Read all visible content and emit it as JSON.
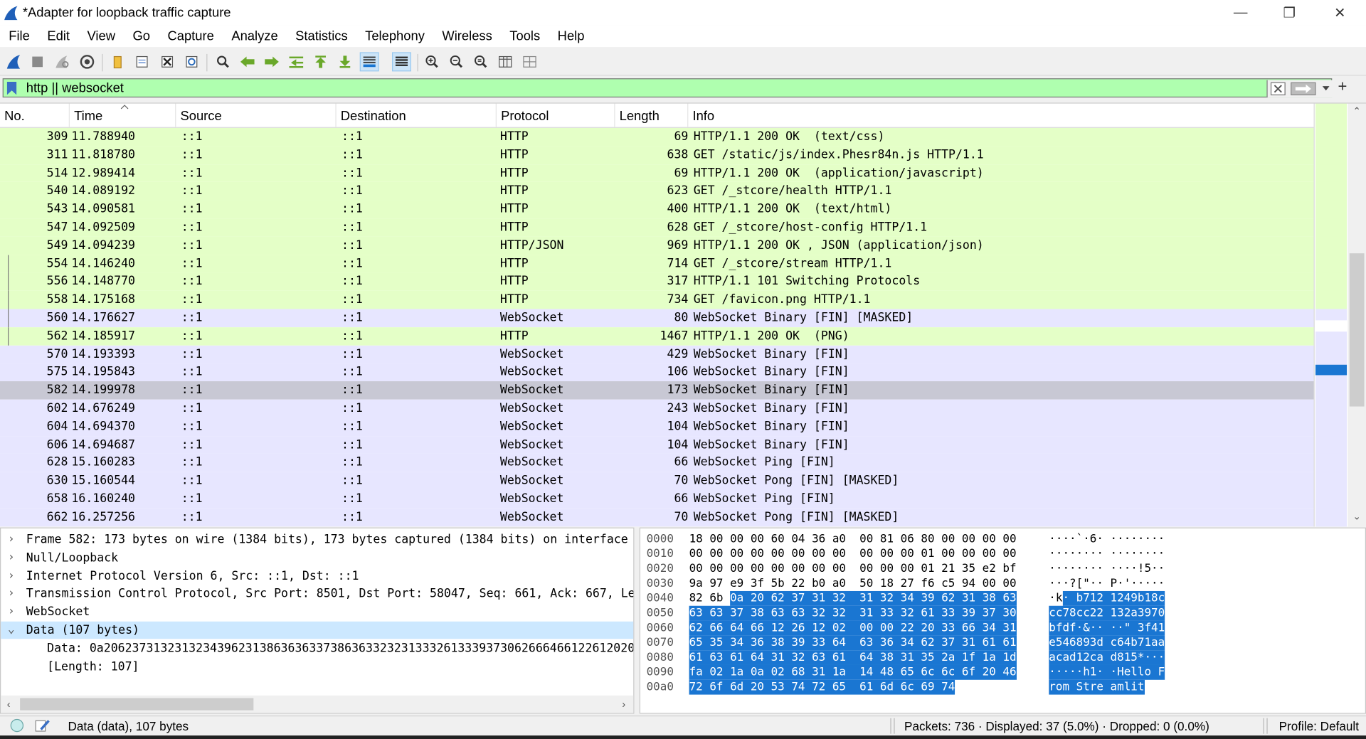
{
  "window": {
    "title": "*Adapter for loopback traffic capture",
    "minimize": "—",
    "restore": "❐",
    "close": "✕"
  },
  "menu": [
    "File",
    "Edit",
    "View",
    "Go",
    "Capture",
    "Analyze",
    "Statistics",
    "Telephony",
    "Wireless",
    "Tools",
    "Help"
  ],
  "filter": {
    "value": "http || websocket",
    "plus": "+"
  },
  "columns": [
    "No.",
    "Time",
    "Source",
    "Destination",
    "Protocol",
    "Length",
    "Info"
  ],
  "packets": [
    {
      "no": "309",
      "time": "11.788940",
      "src": "::1",
      "dst": "::1",
      "proto": "HTTP",
      "len": "69",
      "info": "HTTP/1.1 200 OK  (text/css)",
      "kind": "http"
    },
    {
      "no": "311",
      "time": "11.818780",
      "src": "::1",
      "dst": "::1",
      "proto": "HTTP",
      "len": "638",
      "info": "GET /static/js/index.Phesr84n.js HTTP/1.1",
      "kind": "http"
    },
    {
      "no": "514",
      "time": "12.989414",
      "src": "::1",
      "dst": "::1",
      "proto": "HTTP",
      "len": "69",
      "info": "HTTP/1.1 200 OK  (application/javascript)",
      "kind": "http"
    },
    {
      "no": "540",
      "time": "14.089192",
      "src": "::1",
      "dst": "::1",
      "proto": "HTTP",
      "len": "623",
      "info": "GET /_stcore/health HTTP/1.1",
      "kind": "http"
    },
    {
      "no": "543",
      "time": "14.090581",
      "src": "::1",
      "dst": "::1",
      "proto": "HTTP",
      "len": "400",
      "info": "HTTP/1.1 200 OK  (text/html)",
      "kind": "http"
    },
    {
      "no": "547",
      "time": "14.092509",
      "src": "::1",
      "dst": "::1",
      "proto": "HTTP",
      "len": "628",
      "info": "GET /_stcore/host-config HTTP/1.1",
      "kind": "http"
    },
    {
      "no": "549",
      "time": "14.094239",
      "src": "::1",
      "dst": "::1",
      "proto": "HTTP/JSON",
      "len": "969",
      "info": "HTTP/1.1 200 OK , JSON (application/json)",
      "kind": "http"
    },
    {
      "no": "554",
      "time": "14.146240",
      "src": "::1",
      "dst": "::1",
      "proto": "HTTP",
      "len": "714",
      "info": "GET /_stcore/stream HTTP/1.1",
      "kind": "http"
    },
    {
      "no": "556",
      "time": "14.148770",
      "src": "::1",
      "dst": "::1",
      "proto": "HTTP",
      "len": "317",
      "info": "HTTP/1.1 101 Switching Protocols",
      "kind": "http"
    },
    {
      "no": "558",
      "time": "14.175168",
      "src": "::1",
      "dst": "::1",
      "proto": "HTTP",
      "len": "734",
      "info": "GET /favicon.png HTTP/1.1",
      "kind": "http"
    },
    {
      "no": "560",
      "time": "14.176627",
      "src": "::1",
      "dst": "::1",
      "proto": "WebSocket",
      "len": "80",
      "info": "WebSocket Binary [FIN] [MASKED]",
      "kind": "ws"
    },
    {
      "no": "562",
      "time": "14.185917",
      "src": "::1",
      "dst": "::1",
      "proto": "HTTP",
      "len": "1467",
      "info": "HTTP/1.1 200 OK  (PNG)",
      "kind": "http"
    },
    {
      "no": "570",
      "time": "14.193393",
      "src": "::1",
      "dst": "::1",
      "proto": "WebSocket",
      "len": "429",
      "info": "WebSocket Binary [FIN]",
      "kind": "ws"
    },
    {
      "no": "575",
      "time": "14.195843",
      "src": "::1",
      "dst": "::1",
      "proto": "WebSocket",
      "len": "106",
      "info": "WebSocket Binary [FIN]",
      "kind": "ws"
    },
    {
      "no": "582",
      "time": "14.199978",
      "src": "::1",
      "dst": "::1",
      "proto": "WebSocket",
      "len": "173",
      "info": "WebSocket Binary [FIN]",
      "kind": "sel"
    },
    {
      "no": "602",
      "time": "14.676249",
      "src": "::1",
      "dst": "::1",
      "proto": "WebSocket",
      "len": "243",
      "info": "WebSocket Binary [FIN]",
      "kind": "ws"
    },
    {
      "no": "604",
      "time": "14.694370",
      "src": "::1",
      "dst": "::1",
      "proto": "WebSocket",
      "len": "104",
      "info": "WebSocket Binary [FIN]",
      "kind": "ws"
    },
    {
      "no": "606",
      "time": "14.694687",
      "src": "::1",
      "dst": "::1",
      "proto": "WebSocket",
      "len": "104",
      "info": "WebSocket Binary [FIN]",
      "kind": "ws"
    },
    {
      "no": "628",
      "time": "15.160283",
      "src": "::1",
      "dst": "::1",
      "proto": "WebSocket",
      "len": "66",
      "info": "WebSocket Ping [FIN]",
      "kind": "ws"
    },
    {
      "no": "630",
      "time": "15.160544",
      "src": "::1",
      "dst": "::1",
      "proto": "WebSocket",
      "len": "70",
      "info": "WebSocket Pong [FIN] [MASKED]",
      "kind": "ws"
    },
    {
      "no": "658",
      "time": "16.160240",
      "src": "::1",
      "dst": "::1",
      "proto": "WebSocket",
      "len": "66",
      "info": "WebSocket Ping [FIN]",
      "kind": "ws"
    },
    {
      "no": "662",
      "time": "16.257256",
      "src": "::1",
      "dst": "::1",
      "proto": "WebSocket",
      "len": "70",
      "info": "WebSocket Pong [FIN] [MASKED]",
      "kind": "ws"
    }
  ],
  "details": [
    {
      "arrow": "›",
      "text": "Frame 582: 173 bytes on wire (1384 bits), 173 bytes captured (1384 bits) on interface",
      "sub": false,
      "selected": false
    },
    {
      "arrow": "›",
      "text": "Null/Loopback",
      "sub": false,
      "selected": false
    },
    {
      "arrow": "›",
      "text": "Internet Protocol Version 6, Src: ::1, Dst: ::1",
      "sub": false,
      "selected": false
    },
    {
      "arrow": "›",
      "text": "Transmission Control Protocol, Src Port: 8501, Dst Port: 58047, Seq: 661, Ack: 667, Le",
      "sub": false,
      "selected": false
    },
    {
      "arrow": "›",
      "text": "WebSocket",
      "sub": false,
      "selected": false
    },
    {
      "arrow": "⌄",
      "text": "Data (107 bytes)",
      "sub": false,
      "selected": true
    },
    {
      "arrow": "",
      "text": "Data: 0a206237313231323439623138636363373863633232313332613339373062666466122612020",
      "sub": true,
      "selected": false
    },
    {
      "arrow": "",
      "text": "[Length: 107]",
      "sub": true,
      "selected": false
    }
  ],
  "bytes": [
    {
      "off": "0000",
      "hex_plain": "18 00 00 00 60 04 36 a0  00 81 06 80 00 00 00 00",
      "hex_hl": "",
      "asc_plain": "····`·6· ········",
      "asc_hl": ""
    },
    {
      "off": "0010",
      "hex_plain": "00 00 00 00 00 00 00 00  00 00 00 01 00 00 00 00",
      "hex_hl": "",
      "asc_plain": "········ ········",
      "asc_hl": ""
    },
    {
      "off": "0020",
      "hex_plain": "00 00 00 00 00 00 00 00  00 00 00 01 21 35 e2 bf",
      "hex_hl": "",
      "asc_plain": "········ ····!5··",
      "asc_hl": ""
    },
    {
      "off": "0030",
      "hex_plain": "9a 97 e9 3f 5b 22 b0 a0  50 18 27 f6 c5 94 00 00",
      "hex_hl": "",
      "asc_plain": "···?[\"·· P·'·····",
      "asc_hl": ""
    },
    {
      "off": "0040",
      "hex_plain": "82 6b ",
      "hex_hl": "0a 20 62 37 31 32  31 32 34 39 62 31 38 63",
      "asc_plain": "·k",
      "asc_hl": "· b712 1249b18c"
    },
    {
      "off": "0050",
      "hex_plain": "",
      "hex_hl": "63 63 37 38 63 63 32 32  31 33 32 61 33 39 37 30",
      "asc_plain": "",
      "asc_hl": "cc78cc22 132a3970"
    },
    {
      "off": "0060",
      "hex_plain": "",
      "hex_hl": "62 66 64 66 12 26 12 02  00 00 22 20 33 66 34 31",
      "asc_plain": "",
      "asc_hl": "bfdf·&·· ··\" 3f41"
    },
    {
      "off": "0070",
      "hex_plain": "",
      "hex_hl": "65 35 34 36 38 39 33 64  63 36 34 62 37 31 61 61",
      "asc_plain": "",
      "asc_hl": "e546893d c64b71aa"
    },
    {
      "off": "0080",
      "hex_plain": "",
      "hex_hl": "61 63 61 64 31 32 63 61  64 38 31 35 2a 1f 1a 1d",
      "asc_plain": "",
      "asc_hl": "acad12ca d815*···"
    },
    {
      "off": "0090",
      "hex_plain": "",
      "hex_hl": "fa 02 1a 0a 02 68 31 1a  14 48 65 6c 6c 6f 20 46",
      "asc_plain": "",
      "asc_hl": "·····h1· ·Hello F"
    },
    {
      "off": "00a0",
      "hex_plain": "",
      "hex_hl": "72 6f 6d 20 53 74 72 65  61 6d 6c 69 74",
      "asc_plain": "",
      "asc_hl": "rom Stre amlit"
    }
  ],
  "status": {
    "field_info": "Data (data), 107 bytes",
    "packets": "Packets: 736 · Displayed: 37 (5.0%) · Dropped: 0 (0.0%)",
    "profile": "Profile: Default"
  },
  "colors": {
    "http_row": "#e4ffc7",
    "ws_row": "#e7e6ff",
    "selected_row": "#c8c8d4",
    "filter_ok": "#afffaf",
    "byte_highlight": "#1a76d2"
  },
  "icons": [
    "shark-fin-start-icon",
    "stop-icon",
    "restart-icon",
    "options-gear-icon",
    "open-folder-icon",
    "save-icon",
    "close-file-icon",
    "reload-icon",
    "find-icon",
    "back-arrow-icon",
    "forward-arrow-icon",
    "goto-packet-icon",
    "first-packet-icon",
    "last-packet-icon",
    "autoscroll-icon",
    "colorize-icon",
    "zoom-in-icon",
    "zoom-out-icon",
    "zoom-normal-icon",
    "resize-columns-icon",
    "layout-icon"
  ]
}
